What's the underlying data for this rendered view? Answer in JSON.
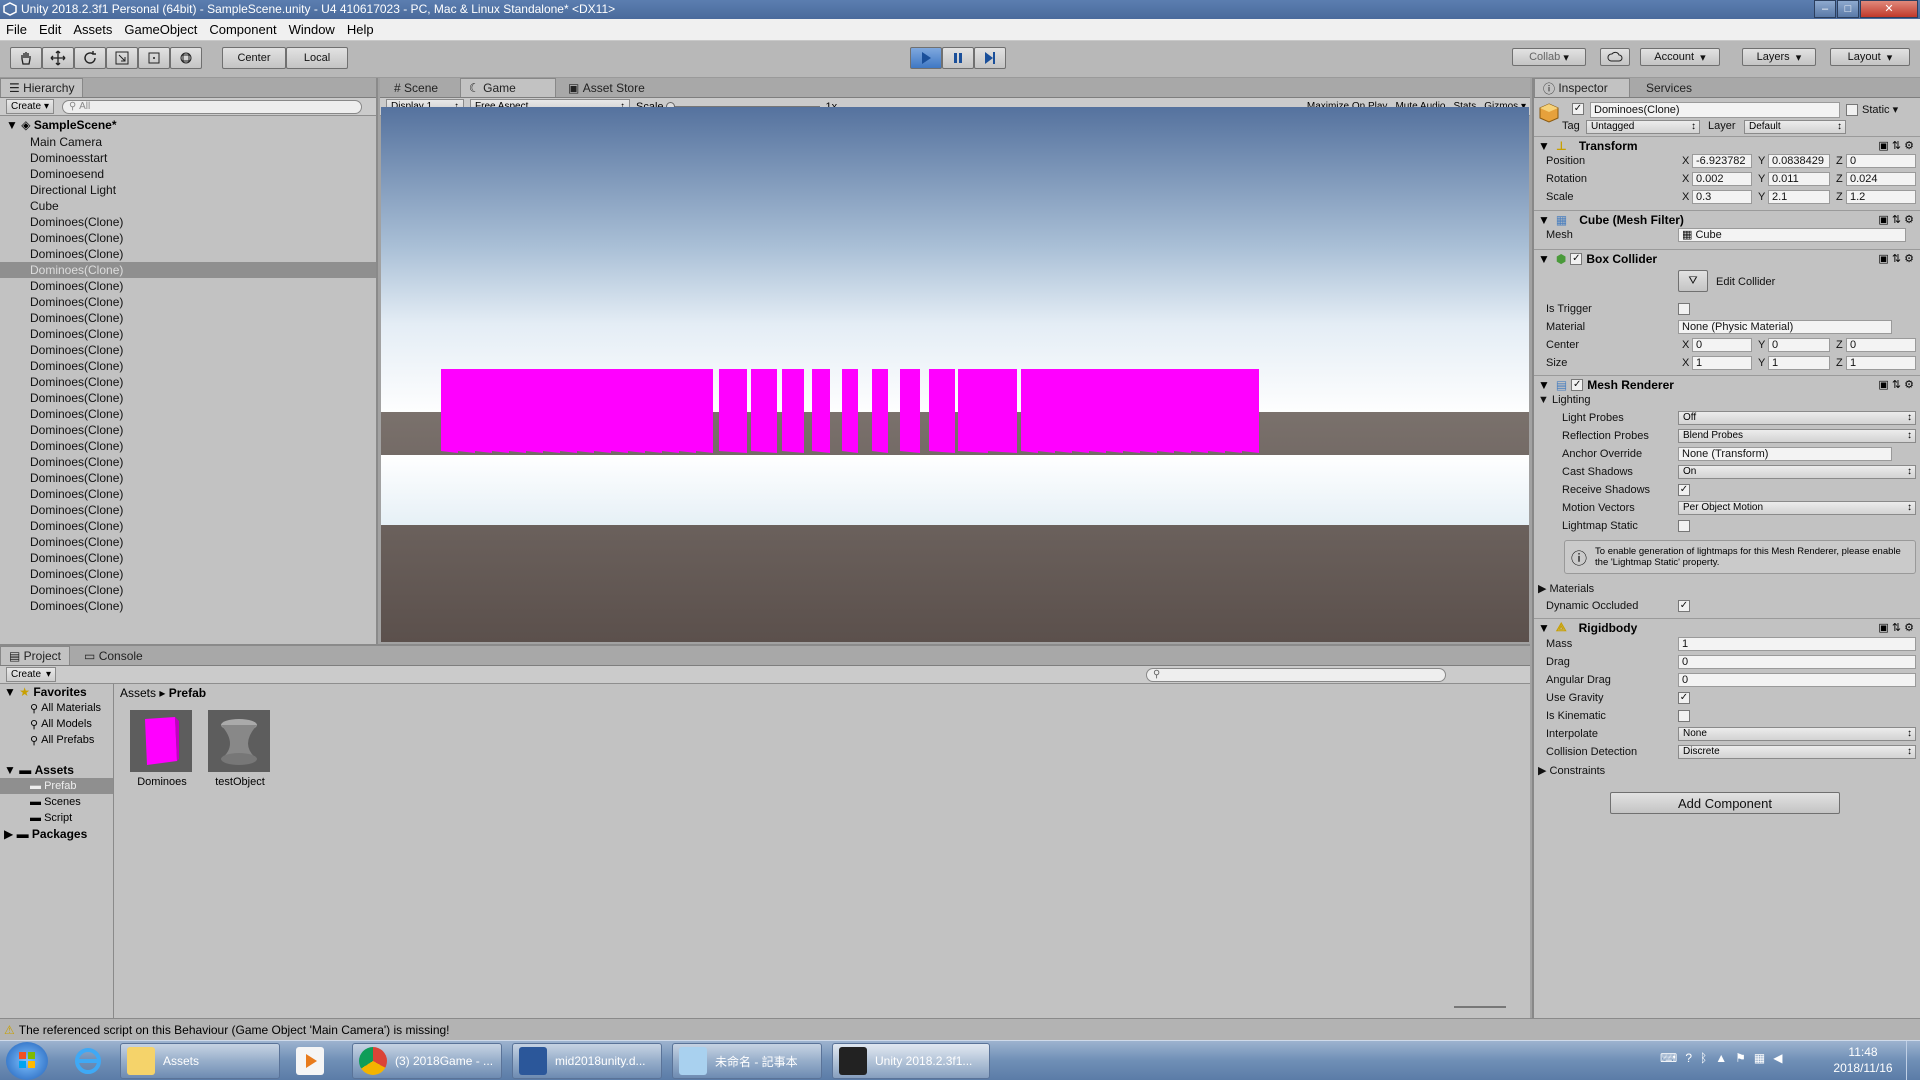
{
  "window": {
    "title": "Unity 2018.2.3f1 Personal (64bit) - SampleScene.unity - U4 410617023 - PC, Mac & Linux Standalone* <DX11>"
  },
  "menu": [
    "File",
    "Edit",
    "Assets",
    "GameObject",
    "Component",
    "Window",
    "Help"
  ],
  "toolbar": {
    "pivot": "Center",
    "space": "Local",
    "collab": "Collab",
    "account": "Account",
    "layers": "Layers",
    "layout": "Layout"
  },
  "hierarchy": {
    "tab": "Hierarchy",
    "create": "Create",
    "search_placeholder": "All",
    "scene": "SampleScene*",
    "items": [
      "Main Camera",
      "Dominoesstart",
      "Dominoesend",
      "Directional Light",
      "Cube",
      "Dominoes(Clone)",
      "Dominoes(Clone)",
      "Dominoes(Clone)",
      "Dominoes(Clone)",
      "Dominoes(Clone)",
      "Dominoes(Clone)",
      "Dominoes(Clone)",
      "Dominoes(Clone)",
      "Dominoes(Clone)",
      "Dominoes(Clone)",
      "Dominoes(Clone)",
      "Dominoes(Clone)",
      "Dominoes(Clone)",
      "Dominoes(Clone)",
      "Dominoes(Clone)",
      "Dominoes(Clone)",
      "Dominoes(Clone)",
      "Dominoes(Clone)",
      "Dominoes(Clone)",
      "Dominoes(Clone)",
      "Dominoes(Clone)",
      "Dominoes(Clone)",
      "Dominoes(Clone)",
      "Dominoes(Clone)",
      "Dominoes(Clone)"
    ],
    "selected_index": 8
  },
  "game": {
    "tabs": [
      "Scene",
      "Game",
      "Asset Store"
    ],
    "display": "Display 1",
    "aspect": "Free Aspect",
    "scale_label": "Scale",
    "scale_value": "1x",
    "options": [
      "Maximize On Play",
      "Mute Audio",
      "Stats",
      "Gizmos"
    ],
    "domino_color": "#ff00ff"
  },
  "inspector": {
    "tabs": [
      "Inspector",
      "Services"
    ],
    "object_name": "Dominoes(Clone)",
    "static": "Static",
    "tag_label": "Tag",
    "tag": "Untagged",
    "layer_label": "Layer",
    "layer": "Default",
    "transform": {
      "title": "Transform",
      "position": {
        "label": "Position",
        "x": "-6.923782",
        "y": "0.0838429",
        "z": "0"
      },
      "rotation": {
        "label": "Rotation",
        "x": "0.002",
        "y": "0.011",
        "z": "0.024"
      },
      "scale": {
        "label": "Scale",
        "x": "0.3",
        "y": "2.1",
        "z": "1.2"
      }
    },
    "mesh_filter": {
      "title": "Cube (Mesh Filter)",
      "mesh_label": "Mesh",
      "mesh": "Cube"
    },
    "box_collider": {
      "title": "Box Collider",
      "edit": "Edit Collider",
      "is_trigger": "Is Trigger",
      "material_label": "Material",
      "material": "None (Physic Material)",
      "center_label": "Center",
      "center": {
        "x": "0",
        "y": "0",
        "z": "0"
      },
      "size_label": "Size",
      "size": {
        "x": "1",
        "y": "1",
        "z": "1"
      }
    },
    "mesh_renderer": {
      "title": "Mesh Renderer",
      "lighting": "Lighting",
      "light_probes_label": "Light Probes",
      "light_probes": "Off",
      "reflection_label": "Reflection Probes",
      "reflection": "Blend Probes",
      "anchor_label": "Anchor Override",
      "anchor": "None (Transform)",
      "cast_label": "Cast Shadows",
      "cast": "On",
      "receive_label": "Receive Shadows",
      "motion_label": "Motion Vectors",
      "motion": "Per Object Motion",
      "lightmap_label": "Lightmap Static",
      "info": "To enable generation of lightmaps for this Mesh Renderer, please enable the 'Lightmap Static' property.",
      "materials": "Materials",
      "dynamic_label": "Dynamic Occluded"
    },
    "rigidbody": {
      "title": "Rigidbody",
      "mass_label": "Mass",
      "mass": "1",
      "drag_label": "Drag",
      "drag": "0",
      "angular_label": "Angular Drag",
      "angular": "0",
      "gravity_label": "Use Gravity",
      "kinematic_label": "Is Kinematic",
      "interpolate_label": "Interpolate",
      "interpolate": "None",
      "collision_label": "Collision Detection",
      "collision": "Discrete",
      "constraints": "Constraints"
    },
    "add_component": "Add Component"
  },
  "project": {
    "tabs": [
      "Project",
      "Console"
    ],
    "create": "Create",
    "favorites": "Favorites",
    "fav_items": [
      "All Materials",
      "All Models",
      "All Prefabs"
    ],
    "assets": "Assets",
    "asset_items": [
      "Prefab",
      "Scenes",
      "Script"
    ],
    "packages": "Packages",
    "breadcrumb": [
      "Assets",
      "Prefab"
    ],
    "files": [
      "Dominoes",
      "testObject"
    ]
  },
  "status": "The referenced script on this Behaviour (Game Object 'Main Camera') is missing!",
  "taskbar": {
    "items": [
      "Assets",
      "(3) 2018Game - ...",
      "mid2018unity.d...",
      "未命名 - 記事本",
      "Unity 2018.2.3f1..."
    ],
    "time": "11:48",
    "date": "2018/11/16"
  }
}
